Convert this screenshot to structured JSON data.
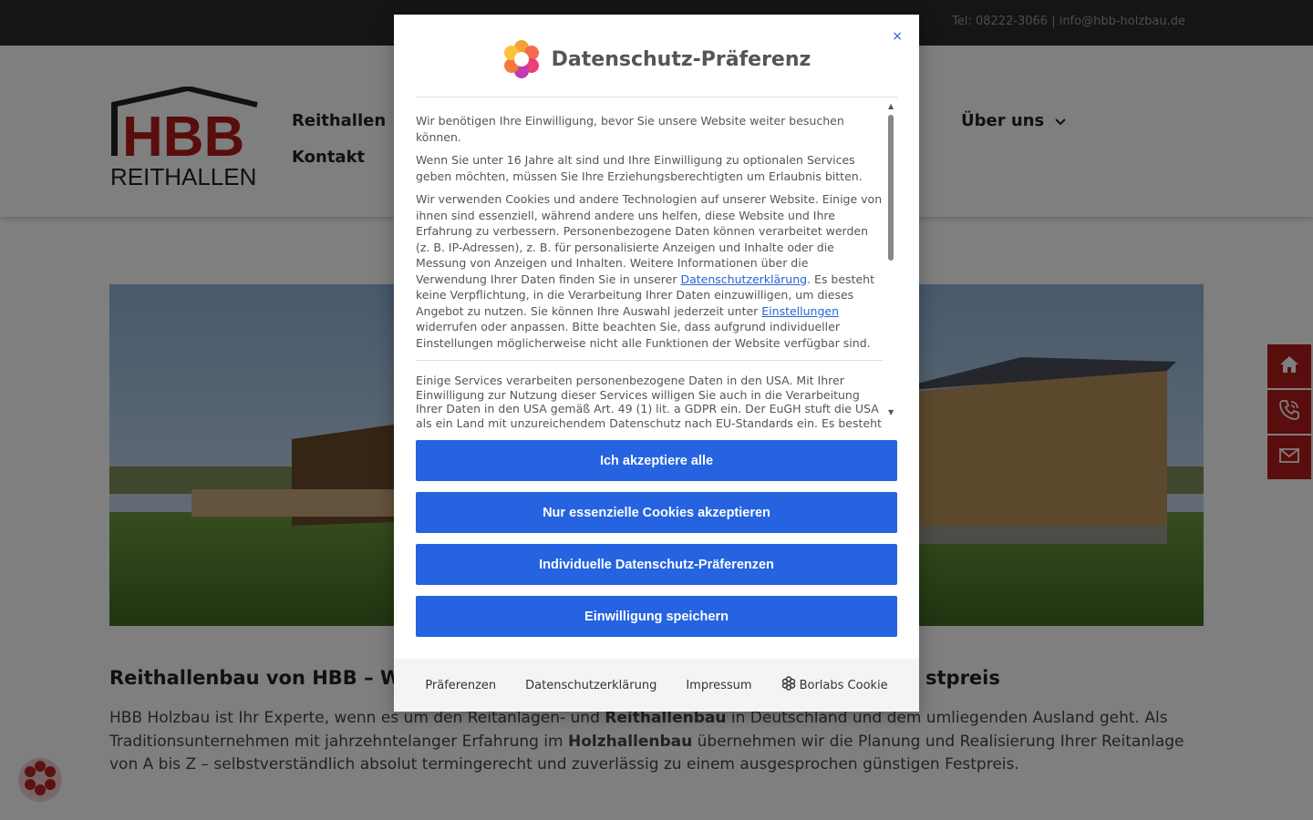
{
  "topbar": {
    "contact": "Tel: 08222-3066 | info@hbb-holzbau.de"
  },
  "logo": {
    "letters": "HBB",
    "subtitle": "REITHALLEN"
  },
  "nav": {
    "reithallen": "Reithallen",
    "kontakt": "Kontakt",
    "ueber_uns": "Über uns"
  },
  "content": {
    "title_left": "Reithallenbau von HBB – W",
    "title_right": "stpreis",
    "text_html_parts": {
      "p1": "HBB Holzbau ist Ihr Experte, wenn es um den Reitanlagen- und ",
      "b1": "Reithallenbau",
      "p2": " in Deutschland und dem umliegenden Ausland geht. Als Traditionsunternehmen mit jahrzehntelanger Erfahrung im ",
      "b2": "Holzhallenbau",
      "p3": " übernehmen wir die Planung und Realisierung Ihrer Reitanlage von A bis Z – selbstverständlich absolut termingerecht und zuverlässig zu einem ausgesprochen günstigen Festpreis."
    }
  },
  "side_buttons": [
    "home-icon",
    "phone-icon",
    "mail-icon"
  ],
  "modal": {
    "close": "×",
    "title": "Datenschutz-Präferenz",
    "para1": "Wir benötigen Ihre Einwilligung, bevor Sie unsere Website weiter besuchen können.",
    "para2": "Wenn Sie unter 16 Jahre alt sind und Ihre Einwilligung zu optionalen Services geben möchten, müssen Sie Ihre Erziehungsberechtigten um Erlaubnis bitten.",
    "para3_a": "Wir verwenden Cookies und andere Technologien auf unserer Website. Einige von ihnen sind essenziell, während andere uns helfen, diese Website und Ihre Erfahrung zu verbessern. Personenbezogene Daten können verarbeitet werden (z. B. IP-Adressen), z. B. für personalisierte Anzeigen und Inhalte oder die Messung von Anzeigen und Inhalten. Weitere Informationen über die Verwendung Ihrer Daten finden Sie in unserer ",
    "para3_link1": "Datenschutzerklärung",
    "para3_b": ". Es besteht keine Verpflichtung, in die Verarbeitung Ihrer Daten einzuwilligen, um dieses Angebot zu nutzen. Sie können Ihre Auswahl jederzeit unter ",
    "para3_link2": "Einstellungen",
    "para3_c": " widerrufen oder anpassen. Bitte beachten Sie, dass aufgrund individueller Einstellungen möglicherweise nicht alle Funktionen der Website verfügbar sind.",
    "para4": "Einige Services verarbeiten personenbezogene Daten in den USA. Mit Ihrer Einwilligung zur Nutzung dieser Services willigen Sie auch in die Verarbeitung Ihrer Daten in den USA gemäß Art. 49 (1) lit. a GDPR ein. Der EuGH stuft die USA als ein Land mit unzureichendem Datenschutz nach EU-Standards ein. Es besteht",
    "buttons": {
      "accept_all": "Ich akzeptiere alle",
      "essential": "Nur essenzielle Cookies akzeptieren",
      "individual": "Individuelle Datenschutz-Präferenzen",
      "save": "Einwilligung speichern"
    },
    "footer": {
      "preferences": "Präferenzen",
      "privacy": "Datenschutzerklärung",
      "imprint": "Impressum",
      "borlabs": "Borlabs Cookie"
    }
  }
}
